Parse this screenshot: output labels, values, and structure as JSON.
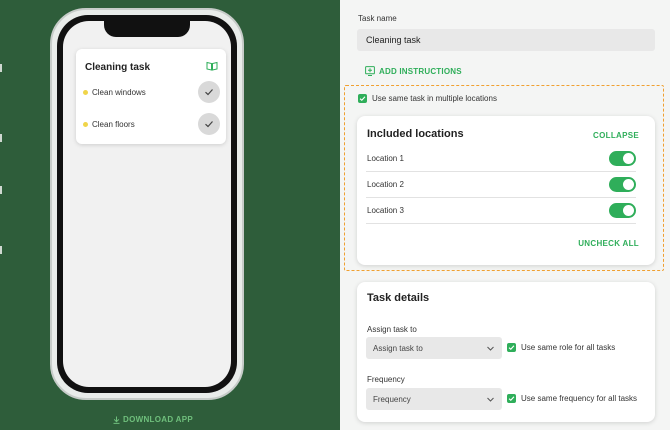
{
  "preview": {
    "card_title": "Cleaning task",
    "tasks": [
      {
        "label": "Clean windows"
      },
      {
        "label": "Clean floors"
      }
    ],
    "download_label": "DOWNLOAD APP"
  },
  "form": {
    "task_name": {
      "label": "Task name",
      "value": "Cleaning task"
    },
    "add_instructions_label": "ADD INSTRUCTIONS",
    "multi_location_checkbox": {
      "label": "Use same task in multiple locations",
      "checked": true
    },
    "included_locations": {
      "title": "Included locations",
      "collapse_label": "COLLAPSE",
      "locations": [
        {
          "label": "Location 1",
          "enabled": true
        },
        {
          "label": "Location 2",
          "enabled": true
        },
        {
          "label": "Location 3",
          "enabled": true
        }
      ],
      "uncheck_all_label": "UNCHECK ALL"
    },
    "task_details": {
      "title": "Task details",
      "assign": {
        "label": "Assign task to",
        "select_value": "Assign task to",
        "checkbox_label": "Use same role for all tasks",
        "checked": true
      },
      "frequency": {
        "label": "Frequency",
        "select_value": "Frequency",
        "checkbox_label": "Use same frequency for all tasks",
        "checked": true
      }
    }
  },
  "colors": {
    "panel_green": "#2e5d3a",
    "accent_green": "#2fae5a",
    "highlight_orange": "#f0a030",
    "bullet_yellow": "#f0d54a"
  }
}
